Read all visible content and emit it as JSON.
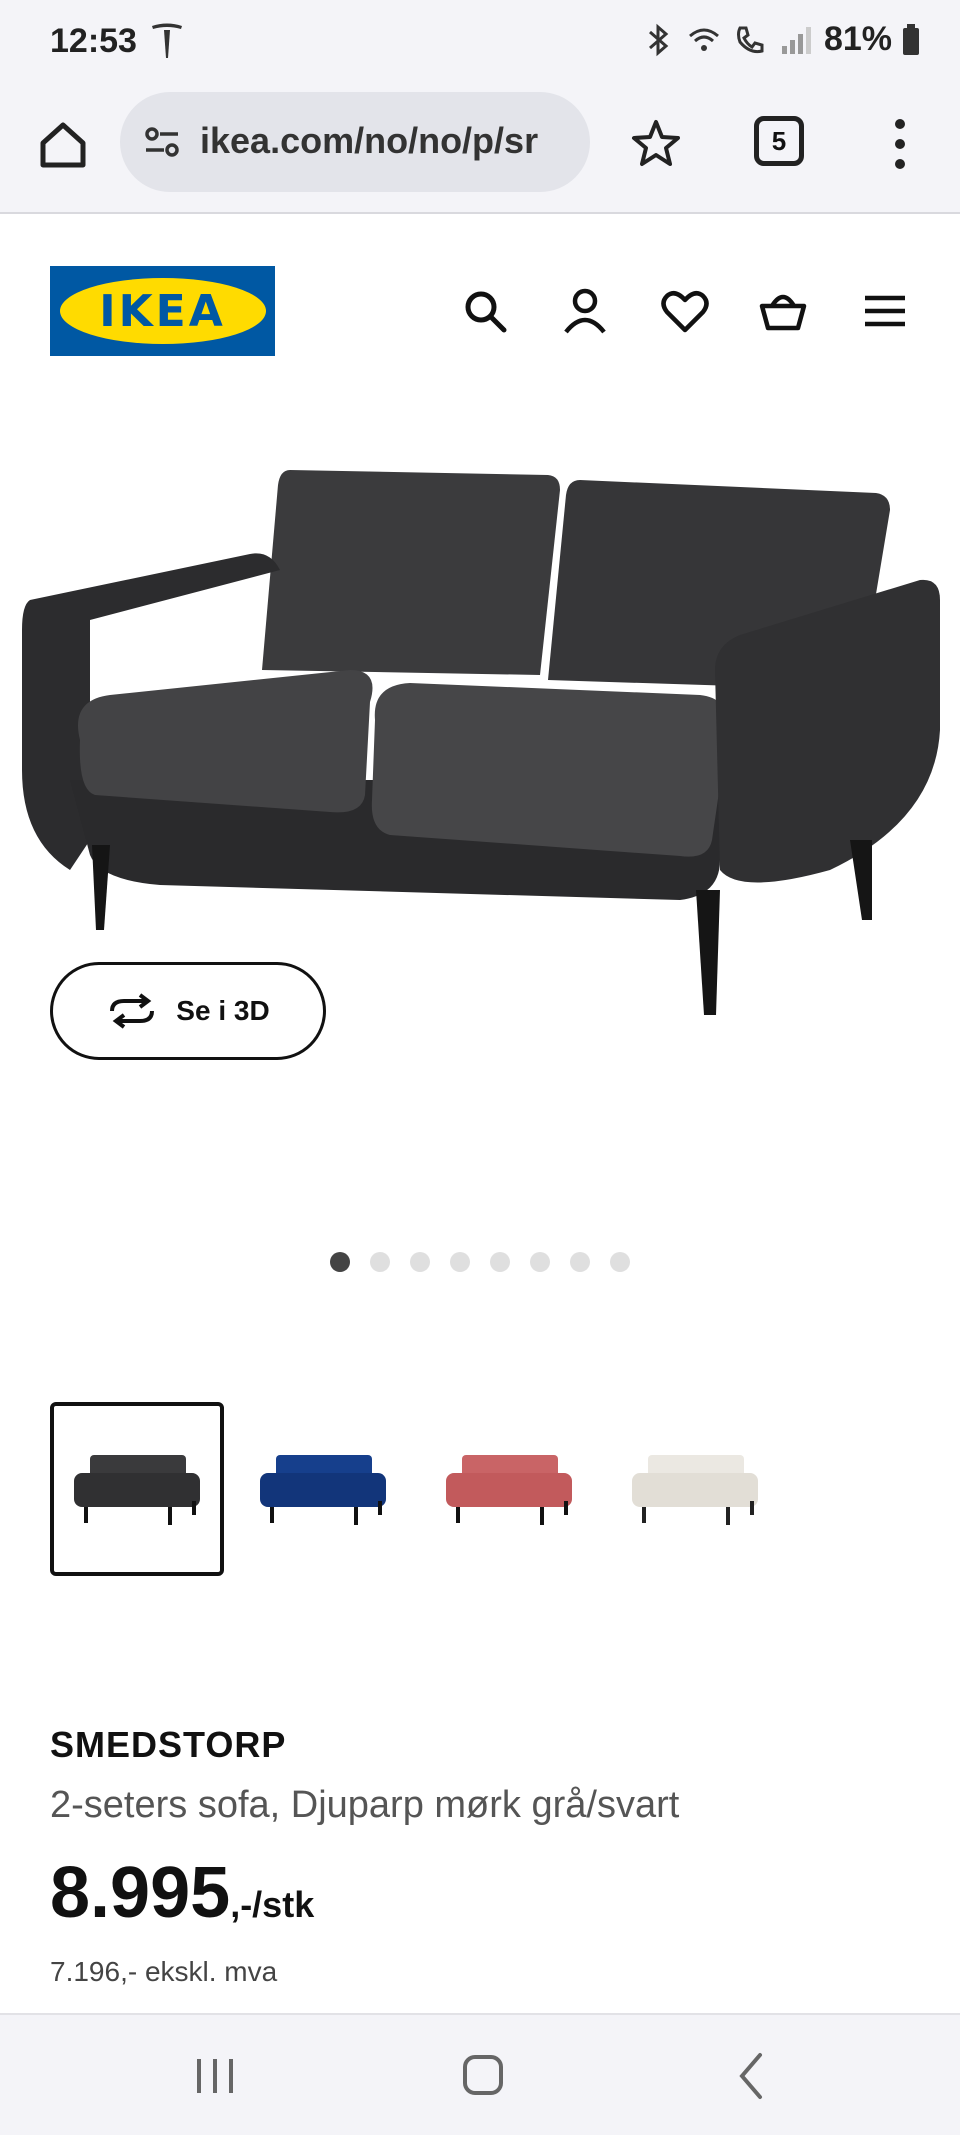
{
  "status_bar": {
    "time": "12:53",
    "battery": "81%"
  },
  "browser": {
    "url": "ikea.com/no/no/p/sr",
    "tab_count": "5"
  },
  "site": {
    "logo_text": "IKEA",
    "brand_blue": "#0058a3",
    "brand_yellow": "#ffdb00"
  },
  "gallery": {
    "view_3d_label": "Se i 3D",
    "image_count": 8,
    "active_index": 0
  },
  "variants": [
    {
      "color": "dark grey",
      "swatch": "#3a3a3c",
      "selected": true
    },
    {
      "color": "blue",
      "swatch": "#12357a",
      "selected": false
    },
    {
      "color": "red",
      "swatch": "#c25a5c",
      "selected": false
    },
    {
      "color": "beige",
      "swatch": "#e7e3dc",
      "selected": false
    }
  ],
  "product": {
    "name": "SMEDSTORP",
    "description": "2-seters sofa, Djuparp mørk grå/svart",
    "price_integer": "8.995",
    "price_suffix": ",-/stk",
    "price_ex_vat": "7.196,- ekskl. mva"
  }
}
